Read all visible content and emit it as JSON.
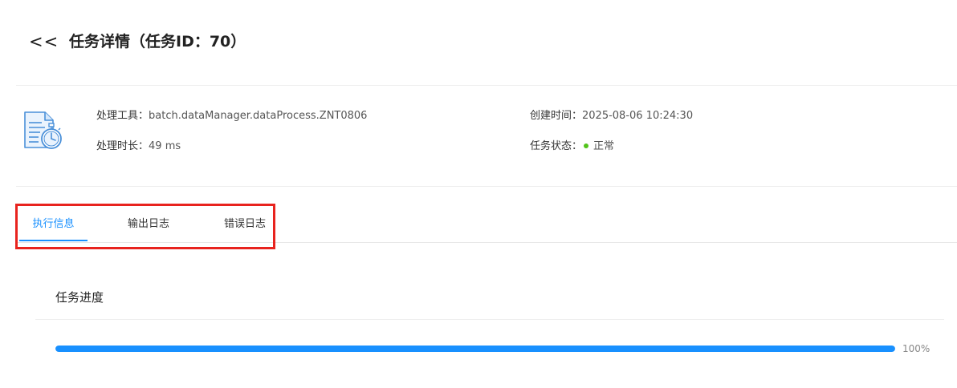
{
  "header": {
    "back_label": "<<",
    "title": "任务详情（任务ID：70）"
  },
  "info": {
    "icon": "document-stopwatch-icon",
    "tool_label": "处理工具：",
    "tool_value": "batch.dataManager.dataProcess.ZNT0806",
    "duration_label": "处理时长：",
    "duration_value": "49 ms",
    "created_label": "创建时间：",
    "created_value": "2025-08-06 10:24:30",
    "status_label": "任务状态：",
    "status_value": "正常",
    "status_color": "#52c41a"
  },
  "tabs": [
    {
      "label": "执行信息",
      "active": true
    },
    {
      "label": "输出日志",
      "active": false
    },
    {
      "label": "错误日志",
      "active": false
    }
  ],
  "progress": {
    "section_title": "任务进度",
    "value": 1.0,
    "text": "100%",
    "color": "#1890ff"
  },
  "colors": {
    "accent": "#1890ff",
    "highlight": "#e8231e"
  }
}
